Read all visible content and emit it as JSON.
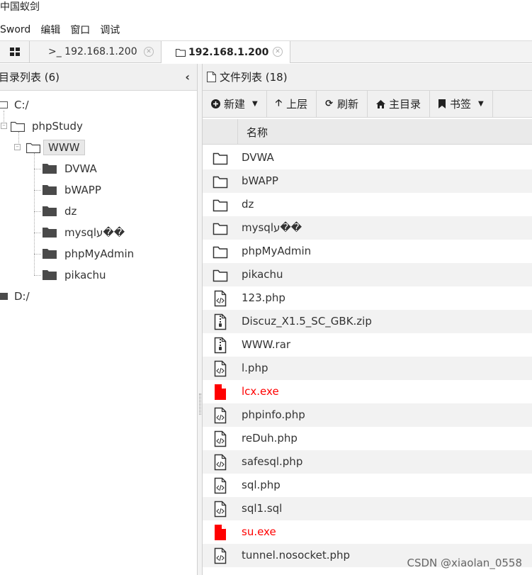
{
  "window": {
    "title": "中国蚁剑"
  },
  "menu": {
    "items": [
      "Sword",
      "编辑",
      "窗口",
      "调试"
    ]
  },
  "tabs": [
    {
      "label": ">_ 192.168.1.200",
      "icon": "terminal-icon"
    },
    {
      "label": "192.168.1.200",
      "icon": "folder-icon"
    }
  ],
  "left": {
    "title": "目录列表 (6)",
    "tree": [
      {
        "label": "C:/",
        "level": 0
      },
      {
        "label": "phpStudy",
        "level": 1
      },
      {
        "label": "WWW",
        "level": 2,
        "selected": true
      },
      {
        "label": "DVWA",
        "level": 3
      },
      {
        "label": "bWAPP",
        "level": 3
      },
      {
        "label": "dz",
        "level": 3
      },
      {
        "label": "mysqlע��",
        "level": 3
      },
      {
        "label": "phpMyAdmin",
        "level": 3
      },
      {
        "label": "pikachu",
        "level": 3
      },
      {
        "label": "D:/",
        "level": 0
      }
    ]
  },
  "right": {
    "title": "文件列表 (18)",
    "toolbar": {
      "new_label": "新建",
      "up_label": "上层",
      "refresh_label": "刷新",
      "home_label": "主目录",
      "bookmark_label": "书签"
    },
    "column_name": "名称",
    "files": [
      {
        "name": "DVWA",
        "type": "folder"
      },
      {
        "name": "bWAPP",
        "type": "folder"
      },
      {
        "name": "dz",
        "type": "folder"
      },
      {
        "name": "mysqlע��",
        "type": "folder"
      },
      {
        "name": "phpMyAdmin",
        "type": "folder"
      },
      {
        "name": "pikachu",
        "type": "folder"
      },
      {
        "name": "123.php",
        "type": "code"
      },
      {
        "name": "Discuz_X1.5_SC_GBK.zip",
        "type": "zip"
      },
      {
        "name": "WWW.rar",
        "type": "zip"
      },
      {
        "name": "l.php",
        "type": "code"
      },
      {
        "name": "lcx.exe",
        "type": "exe"
      },
      {
        "name": "phpinfo.php",
        "type": "code"
      },
      {
        "name": "reDuh.php",
        "type": "code"
      },
      {
        "name": "safesql.php",
        "type": "code"
      },
      {
        "name": "sql.php",
        "type": "code"
      },
      {
        "name": "sql1.sql",
        "type": "code"
      },
      {
        "name": "su.exe",
        "type": "exe"
      },
      {
        "name": "tunnel.nosocket.php",
        "type": "code"
      }
    ]
  },
  "watermark": "CSDN @xiaolan_0558",
  "colors": {
    "exe_text": "#ff0000",
    "alt_row": "#f2f2f2"
  }
}
